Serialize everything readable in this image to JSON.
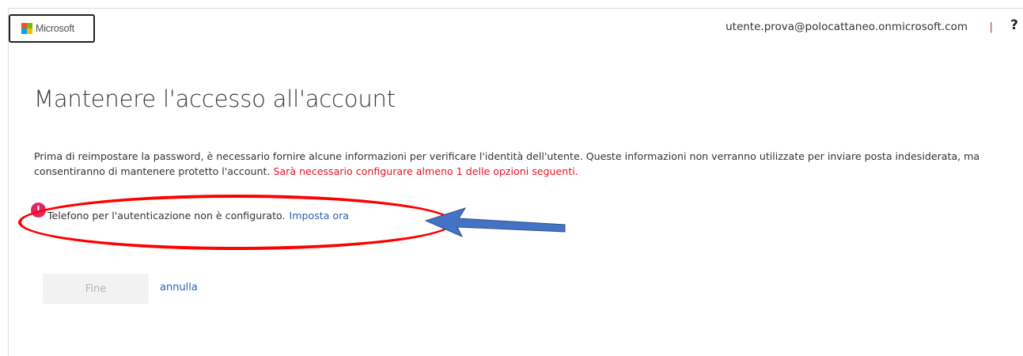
{
  "header": {
    "logo_text": "Microsoft",
    "user_email": "utente.prova@polocattaneo.onmicrosoft.com",
    "separator": "|",
    "help_glyph": "?"
  },
  "page": {
    "title": "Mantenere l'accesso all'account",
    "intro_text": "Prima di reimpostare la password, è necessario fornire alcune informazioni per verificare l'identità dell'utente. Queste informazioni non verranno utilizzate per inviare posta indesiderata, ma consentiranno di mantenere protetto l'account.",
    "required_note": "Sarà necessario configurare almeno 1 delle opzioni seguenti."
  },
  "auth_methods": [
    {
      "icon": "alert-icon",
      "icon_glyph": "!",
      "status_text": "Telefono per l'autenticazione non è configurato.",
      "action_label": "Imposta ora"
    }
  ],
  "actions": {
    "finish_label": "Fine",
    "cancel_label": "annulla"
  },
  "colors": {
    "alert_icon": "#e3266c",
    "required_note": "#e81123",
    "link": "#2f5fb3",
    "annotation_ellipse": "#ff0000",
    "annotation_arrow": "#4472c4"
  }
}
